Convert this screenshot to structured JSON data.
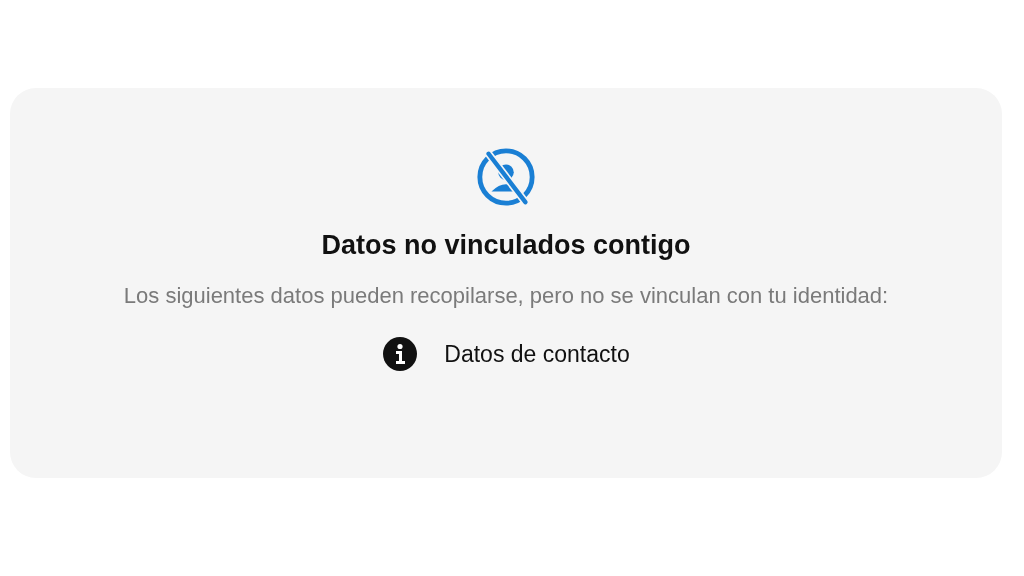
{
  "card": {
    "title": "Datos no vinculados contigo",
    "description": "Los siguientes datos pueden recopilarse, pero no se vinculan con tu identidad:",
    "items": [
      {
        "label": "Datos de contacto"
      }
    ]
  }
}
